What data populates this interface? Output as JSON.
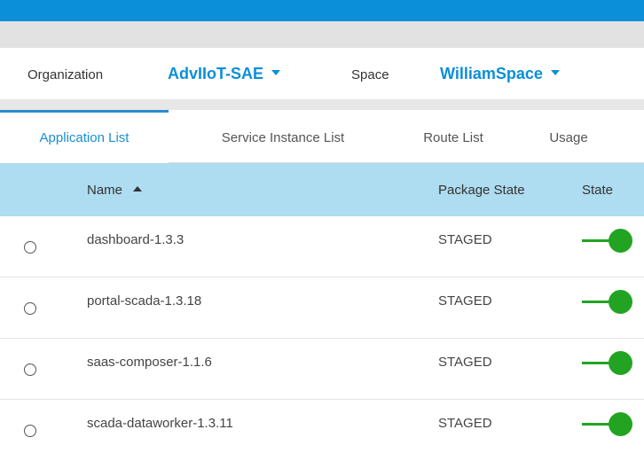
{
  "header": {
    "organization_label": "Organization",
    "organization_value": "AdvIIoT-SAE",
    "space_label": "Space",
    "space_value": "WilliamSpace"
  },
  "tabs": [
    {
      "label": "Application List",
      "active": true
    },
    {
      "label": "Service Instance List",
      "active": false
    },
    {
      "label": "Route List",
      "active": false
    },
    {
      "label": "Usage",
      "active": false
    }
  ],
  "table": {
    "columns": {
      "name": "Name",
      "package_state": "Package State",
      "state": "State"
    },
    "sort": {
      "column": "name",
      "direction": "ascending"
    },
    "rows": [
      {
        "name": "dashboard-1.3.3",
        "package_state": "STAGED",
        "state_on": true
      },
      {
        "name": "portal-scada-1.3.18",
        "package_state": "STAGED",
        "state_on": true
      },
      {
        "name": "saas-composer-1.1.6",
        "package_state": "STAGED",
        "state_on": true
      },
      {
        "name": "scada-dataworker-1.3.11",
        "package_state": "STAGED",
        "state_on": true
      }
    ]
  },
  "colors": {
    "topbar": "#0a8fd8",
    "accent": "#1a8fd0",
    "table_header": "#aedcf0",
    "toggle_on": "#22a422"
  }
}
